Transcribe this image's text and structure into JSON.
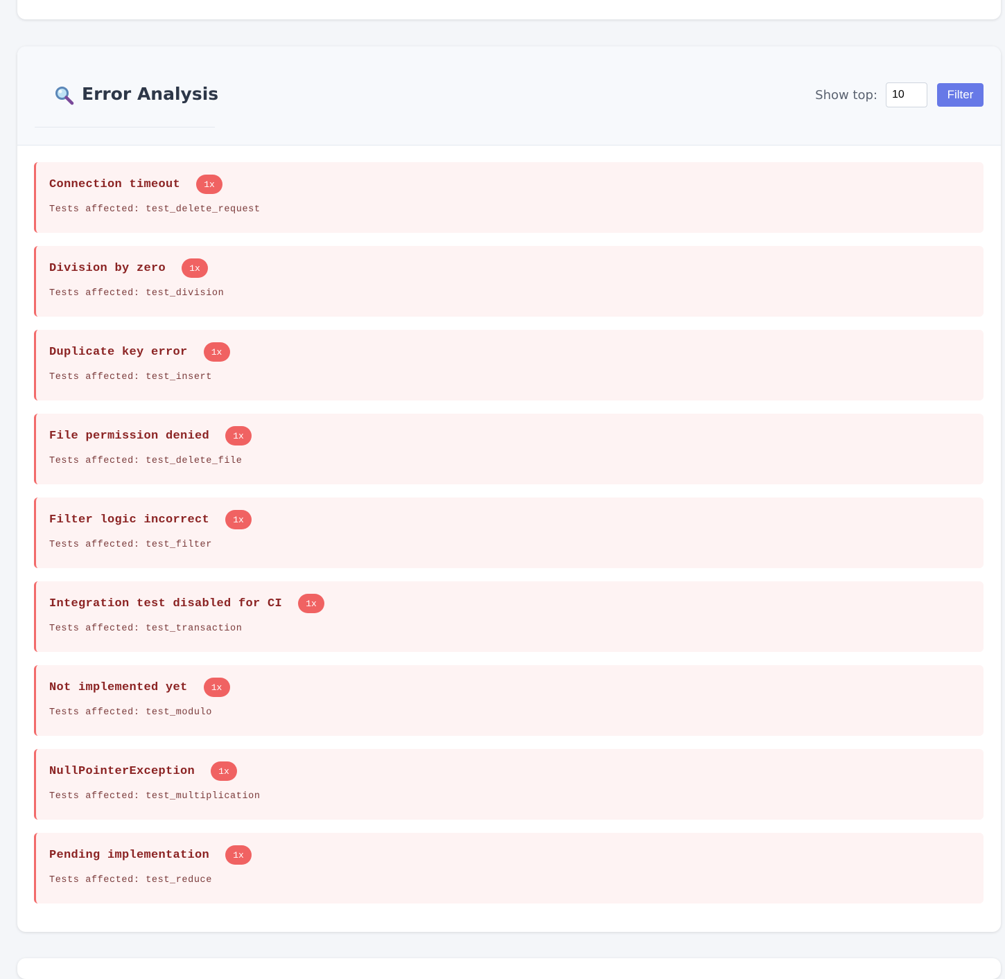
{
  "section": {
    "title": "Error Analysis",
    "icon": "magnifier-icon",
    "show_top_label": "Show top:",
    "show_top_value": "10",
    "filter_label": "Filter"
  },
  "colors": {
    "accent": "#6779e7",
    "error_border": "#f26b6b",
    "error_bg": "#fef3f3",
    "badge": "#f06262"
  },
  "errors": [
    {
      "title": "Connection timeout",
      "count": "1x",
      "tests": "Tests affected: test_delete_request"
    },
    {
      "title": "Division by zero",
      "count": "1x",
      "tests": "Tests affected: test_division"
    },
    {
      "title": "Duplicate key error",
      "count": "1x",
      "tests": "Tests affected: test_insert"
    },
    {
      "title": "File permission denied",
      "count": "1x",
      "tests": "Tests affected: test_delete_file"
    },
    {
      "title": "Filter logic incorrect",
      "count": "1x",
      "tests": "Tests affected: test_filter"
    },
    {
      "title": "Integration test disabled for CI",
      "count": "1x",
      "tests": "Tests affected: test_transaction"
    },
    {
      "title": "Not implemented yet",
      "count": "1x",
      "tests": "Tests affected: test_modulo"
    },
    {
      "title": "NullPointerException",
      "count": "1x",
      "tests": "Tests affected: test_multiplication"
    },
    {
      "title": "Pending implementation",
      "count": "1x",
      "tests": "Tests affected: test_reduce"
    }
  ]
}
